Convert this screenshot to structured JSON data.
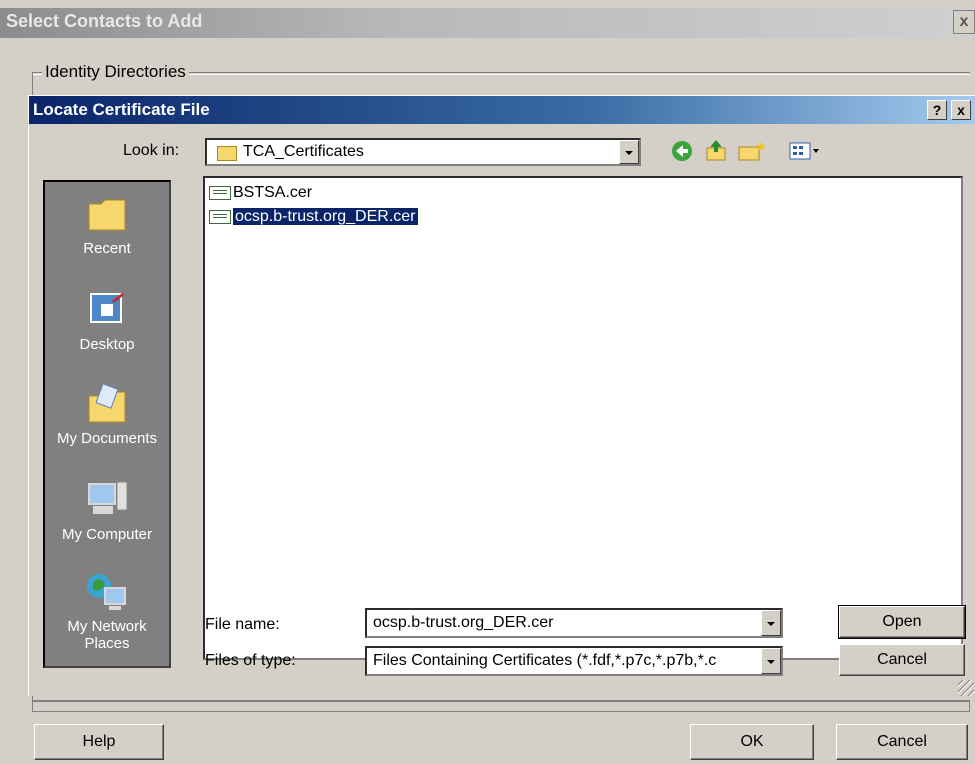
{
  "outer_dialog": {
    "title": "Select Contacts to Add",
    "close_glyph": "x",
    "group_label": "Identity Directories",
    "buttons": {
      "help": "Help",
      "ok": "OK",
      "cancel": "Cancel"
    }
  },
  "file_dialog": {
    "title": "Locate Certificate File",
    "help_glyph": "?",
    "close_glyph": "x",
    "look_in_label": "Look in:",
    "look_in_value": "TCA_Certificates",
    "toolbar": [
      "back-icon",
      "up-folder-icon",
      "new-folder-icon",
      "view-menu-icon"
    ],
    "places": [
      {
        "label": "Recent",
        "icon": "recent-folder-icon"
      },
      {
        "label": "Desktop",
        "icon": "desktop-icon"
      },
      {
        "label": "My Documents",
        "icon": "my-documents-icon"
      },
      {
        "label": "My Computer",
        "icon": "my-computer-icon"
      },
      {
        "label": "My Network Places",
        "icon": "network-places-icon"
      }
    ],
    "files": [
      {
        "name": "BSTSA.cer",
        "selected": false
      },
      {
        "name": "ocsp.b-trust.org_DER.cer",
        "selected": true
      }
    ],
    "file_name_label": "File name:",
    "file_name_value": "ocsp.b-trust.org_DER.cer",
    "file_type_label": "Files of type:",
    "file_type_value": "Files Containing Certificates (*.fdf,*.p7c,*.p7b,*.c",
    "buttons": {
      "open": "Open",
      "cancel": "Cancel"
    }
  }
}
